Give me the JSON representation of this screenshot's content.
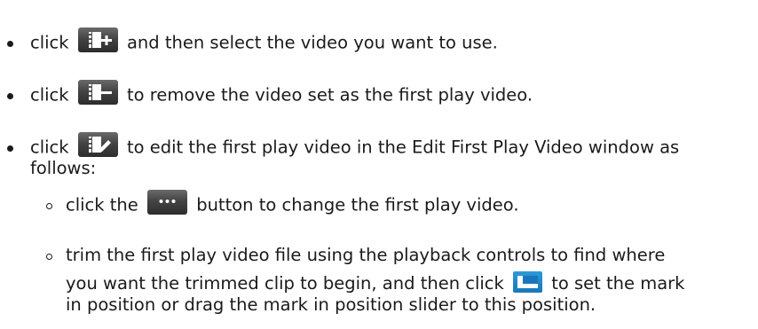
{
  "instructions": {
    "item1": {
      "lead": "click",
      "icon": "add-video-icon",
      "rest": "and then select the video you want to use."
    },
    "item2": {
      "lead": "click",
      "icon": "remove-video-icon",
      "rest": "to remove the video set as the first play video."
    },
    "item3": {
      "lead": "click",
      "icon": "edit-video-icon",
      "rest": "to edit the first play video in the Edit First Play Video window as",
      "rest_line2": "follows:"
    },
    "sub1": {
      "lead": "click the",
      "icon": "browse-ellipsis-icon",
      "rest": "button to change the first play video."
    },
    "sub2": {
      "line1": "trim the first play video file using the playback controls to find where",
      "line2_lead": "you want the trimmed clip to begin, and then click",
      "icon": "mark-in-icon",
      "line2_rest": "to set the mark",
      "line3": "in position or drag the mark in position slider to this position."
    }
  },
  "colors": {
    "text": "#1a1a1a",
    "button_dark": "#444444",
    "button_blue": "#1877bb"
  }
}
